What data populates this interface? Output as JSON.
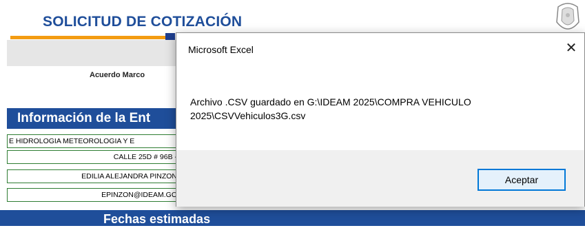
{
  "form": {
    "title": "SOLICITUD DE COTIZACIÓN",
    "subtitle": "Acuerdo Marco",
    "section_header": "Información de la Ent",
    "rows": [
      "E HIDROLOGIA METEOROLOGIA Y E",
      "CALLE 25D # 96B -",
      "EDILIA ALEJANDRA PINZON",
      "EPINZON@IDEAM.GO"
    ],
    "bottom_header": "Fechas estimadas"
  },
  "dialog": {
    "title": "Microsoft Excel",
    "close_glyph": "✕",
    "message": "Archivo .CSV guardado en G:\\IDEAM 2025\\COMPRA VEHICULO 2025\\CSVVehiculos3G.csv",
    "ok_label": "Aceptar"
  },
  "colors": {
    "brand_blue": "#1f4e9a",
    "accent_orange": "#f39c12",
    "row_border": "#2e7d32",
    "button_focus": "#0078d7"
  }
}
